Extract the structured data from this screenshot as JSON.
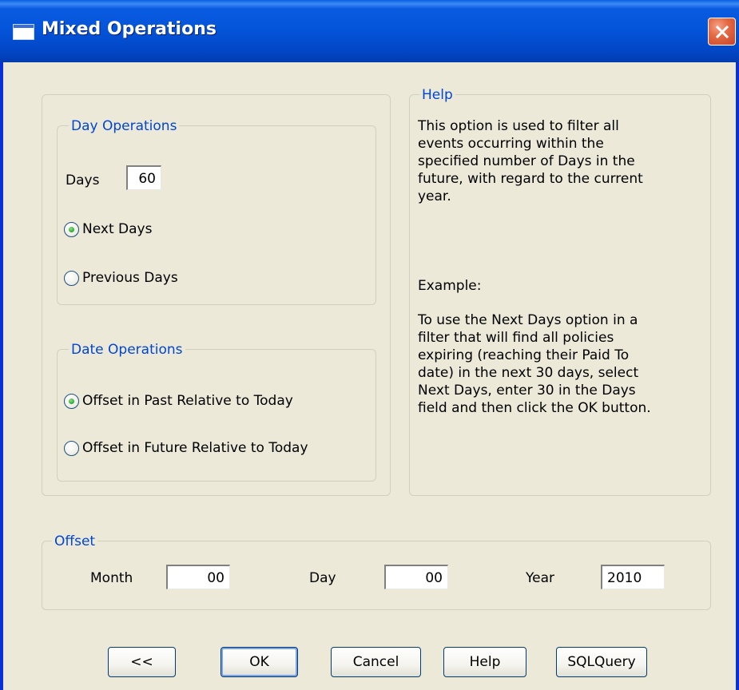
{
  "window": {
    "title": "Mixed Operations"
  },
  "day_operations": {
    "legend": "Day Operations",
    "days_label": "Days",
    "days_value": "60",
    "options": [
      {
        "label": "Next Days",
        "checked": true
      },
      {
        "label": "Previous Days",
        "checked": false
      }
    ]
  },
  "date_operations": {
    "legend": "Date Operations",
    "options": [
      {
        "label": "Offset in Past Relative to Today",
        "checked": true
      },
      {
        "label": "Offset in Future Relative to Today",
        "checked": false
      }
    ]
  },
  "help": {
    "legend": "Help",
    "description": "This option is used to filter all\nevents occurring within the\nspecified number of Days in the\nfuture, with regard to the current\nyear.",
    "example_label": "Example:",
    "example_text": "To use the Next Days option in a\nfilter that will find all policies\nexpiring (reaching their Paid To\ndate) in the next 30 days, select\nNext Days, enter 30 in the Days\nfield and then click the OK button."
  },
  "offset": {
    "legend": "Offset",
    "month_label": "Month",
    "month_value": "00",
    "day_label": "Day",
    "day_value": "00",
    "year_label": "Year",
    "year_value": "2010"
  },
  "buttons": {
    "back": "<<",
    "ok": "OK",
    "cancel": "Cancel",
    "help": "Help",
    "sqlquery": "SQLQuery"
  },
  "colors": {
    "title_bar": "#0455da",
    "legend_text": "#0046d5",
    "dialog_background": "#ece9d8"
  }
}
